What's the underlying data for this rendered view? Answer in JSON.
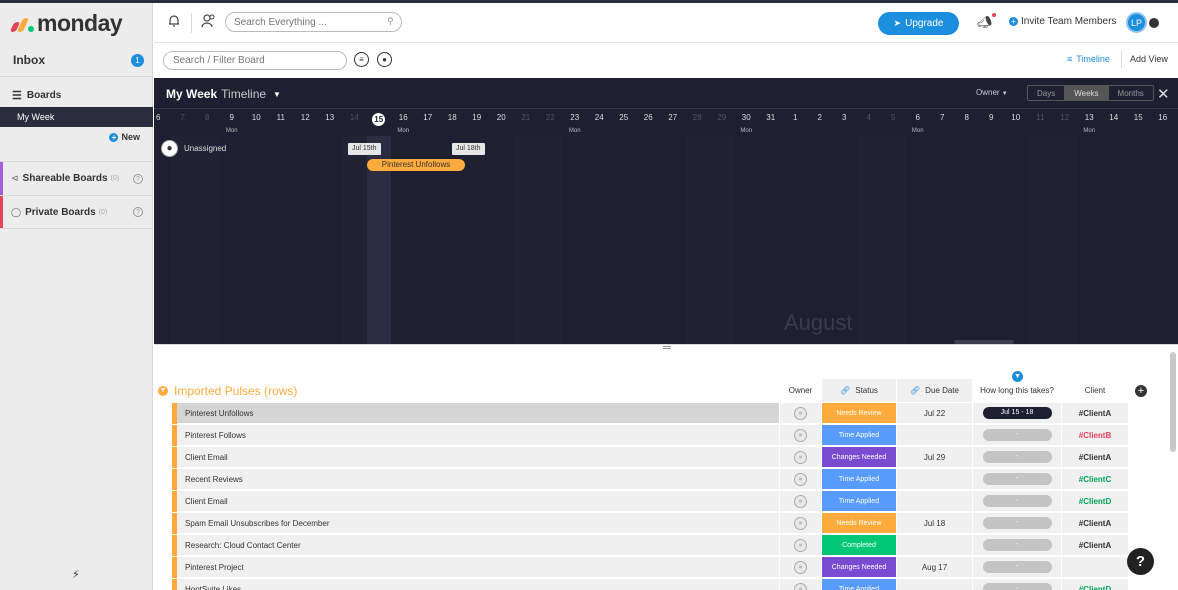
{
  "brand": {
    "name": "monday",
    "colors": [
      "#e2445c",
      "#fdab3d",
      "#00c875"
    ]
  },
  "header": {
    "search_placeholder": "Search Everything ...",
    "upgrade_label": "Upgrade",
    "invite_label": "Invite Team Members",
    "avatar_initials": "LP"
  },
  "sidebar": {
    "inbox_label": "Inbox",
    "inbox_count": "1",
    "boards_label": "Boards",
    "active_board": "My Week",
    "new_label": "New",
    "shareable_label": "Shareable Boards",
    "shareable_count": "(0)",
    "private_label": "Private Boards",
    "private_count": "(0)"
  },
  "boardbar": {
    "filter_placeholder": "Search / Filter Board",
    "timeline_label": "Timeline",
    "add_view_label": "Add View"
  },
  "timeline": {
    "board_name": "My Week",
    "view_name": "Timeline",
    "owner_label": "Owner",
    "scale_options": [
      {
        "label": "Days",
        "active": false
      },
      {
        "label": "Weeks",
        "active": true
      },
      {
        "label": "Months",
        "active": false
      }
    ],
    "days": [
      {
        "d": "6",
        "dim": false,
        "mon": false
      },
      {
        "d": "7",
        "dim": true,
        "mon": false
      },
      {
        "d": "8",
        "dim": true,
        "mon": false
      },
      {
        "d": "9",
        "dim": false,
        "mon": true
      },
      {
        "d": "10",
        "dim": false,
        "mon": false
      },
      {
        "d": "11",
        "dim": false,
        "mon": false
      },
      {
        "d": "12",
        "dim": false,
        "mon": false
      },
      {
        "d": "13",
        "dim": false,
        "mon": false
      },
      {
        "d": "14",
        "dim": true,
        "mon": false
      },
      {
        "d": "15",
        "dim": false,
        "mon": false,
        "today": true
      },
      {
        "d": "16",
        "dim": false,
        "mon": true
      },
      {
        "d": "17",
        "dim": false,
        "mon": false
      },
      {
        "d": "18",
        "dim": false,
        "mon": false
      },
      {
        "d": "19",
        "dim": false,
        "mon": false
      },
      {
        "d": "20",
        "dim": false,
        "mon": false
      },
      {
        "d": "21",
        "dim": true,
        "mon": false
      },
      {
        "d": "22",
        "dim": true,
        "mon": false
      },
      {
        "d": "23",
        "dim": false,
        "mon": true
      },
      {
        "d": "24",
        "dim": false,
        "mon": false
      },
      {
        "d": "25",
        "dim": false,
        "mon": false
      },
      {
        "d": "26",
        "dim": false,
        "mon": false
      },
      {
        "d": "27",
        "dim": false,
        "mon": false
      },
      {
        "d": "28",
        "dim": true,
        "mon": false
      },
      {
        "d": "29",
        "dim": true,
        "mon": false
      },
      {
        "d": "30",
        "dim": false,
        "mon": true
      },
      {
        "d": "31",
        "dim": false,
        "mon": false
      },
      {
        "d": "1",
        "dim": false,
        "mon": false
      },
      {
        "d": "2",
        "dim": false,
        "mon": false
      },
      {
        "d": "3",
        "dim": false,
        "mon": false
      },
      {
        "d": "4",
        "dim": true,
        "mon": false
      },
      {
        "d": "5",
        "dim": true,
        "mon": false
      },
      {
        "d": "6",
        "dim": false,
        "mon": true
      },
      {
        "d": "7",
        "dim": false,
        "mon": false
      },
      {
        "d": "8",
        "dim": false,
        "mon": false
      },
      {
        "d": "9",
        "dim": false,
        "mon": false
      },
      {
        "d": "10",
        "dim": false,
        "mon": false
      },
      {
        "d": "11",
        "dim": true,
        "mon": false
      },
      {
        "d": "12",
        "dim": true,
        "mon": false
      },
      {
        "d": "13",
        "dim": false,
        "mon": true
      },
      {
        "d": "14",
        "dim": false,
        "mon": false
      },
      {
        "d": "15",
        "dim": false,
        "mon": false
      },
      {
        "d": "16",
        "dim": false,
        "mon": false
      }
    ],
    "weekday_label": "Mon",
    "owner_row": "Unassigned",
    "item": {
      "label": "Pinterest Unfollows",
      "start_label": "Jul 15th",
      "end_label": "Jul 18th"
    },
    "month_label": "August"
  },
  "board": {
    "group_title": "Imported Pulses (rows)",
    "columns": {
      "owner": "Owner",
      "status": "Status",
      "due": "Due Date",
      "how_long": "How long this takes?",
      "client": "Client"
    },
    "rows": [
      {
        "name": "Pinterest Unfollows",
        "status": "Needs Review",
        "status_color": "#fdab3d",
        "due": "Jul 22",
        "how_long": "Jul 15 - 18",
        "client": "#ClientA",
        "client_color": "#333333",
        "selected": true
      },
      {
        "name": "Pinterest Follows",
        "status": "Time Applied",
        "status_color": "#579bfc",
        "due": "",
        "how_long": "-",
        "client": "#ClientB",
        "client_color": "#e2445c",
        "selected": false
      },
      {
        "name": "Client Email",
        "status": "Changes Needed",
        "status_color": "#784bd1",
        "due": "Jul 29",
        "how_long": "-",
        "client": "#ClientA",
        "client_color": "#333333",
        "selected": false
      },
      {
        "name": "Recent Reviews",
        "status": "Time Applied",
        "status_color": "#579bfc",
        "due": "",
        "how_long": "-",
        "client": "#ClientC",
        "client_color": "#00a359",
        "selected": false
      },
      {
        "name": "Client Email",
        "status": "Time Applied",
        "status_color": "#579bfc",
        "due": "",
        "how_long": "-",
        "client": "#ClientD",
        "client_color": "#00a359",
        "selected": false
      },
      {
        "name": "Spam Email Unsubscribes for December",
        "status": "Needs Review",
        "status_color": "#fdab3d",
        "due": "Jul 18",
        "how_long": "-",
        "client": "#ClientA",
        "client_color": "#333333",
        "selected": false
      },
      {
        "name": "Research: Cloud Contact Center",
        "status": "Completed",
        "status_color": "#00c875",
        "due": "",
        "how_long": "-",
        "client": "#ClientA",
        "client_color": "#333333",
        "selected": false
      },
      {
        "name": "Pinterest Project",
        "status": "Changes Needed",
        "status_color": "#784bd1",
        "due": "Aug 17",
        "how_long": "-",
        "client": "",
        "client_color": "#333333",
        "selected": false
      },
      {
        "name": "HootSuite Likes",
        "status": "Time Applied",
        "status_color": "#579bfc",
        "due": "",
        "how_long": "-",
        "client": "#ClientD",
        "client_color": "#00a359",
        "selected": false
      }
    ]
  },
  "help_label": "?"
}
